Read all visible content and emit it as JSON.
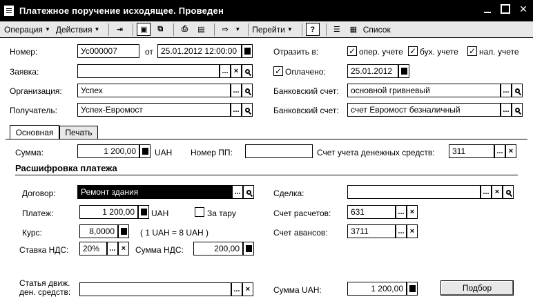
{
  "window": {
    "title": "Платежное поручение исходящее. Проведен",
    "controls": [
      "minimize",
      "maximize",
      "close"
    ]
  },
  "toolbar": {
    "operation": "Операция",
    "actions": "Действия",
    "goto": "Перейти",
    "help": "?",
    "list": "Список"
  },
  "header": {
    "number_label": "Номер:",
    "number_value": "Ус000007",
    "from_label": "от",
    "date_value": "25.01.2012 12:00:00",
    "request_label": "Заявка:",
    "request_value": "",
    "org_label": "Организация:",
    "org_value": "Успех",
    "recipient_label": "Получатель:",
    "recipient_value": "Успех-Евромост",
    "reflect_label": "Отразить в:",
    "reflect_oper": "опер. учете",
    "reflect_buh": "бух. учете",
    "reflect_nal": "нал. учете",
    "paid_label": "Оплачено:",
    "paid_date": "25.01.2012",
    "bank_label_1": "Банковский счет:",
    "bank_value_1": "основной гривневый",
    "bank_label_2": "Банковский счет:",
    "bank_value_2": "счет Евромост безналичный"
  },
  "tabs": {
    "main": "Основная",
    "print": "Печать"
  },
  "main_tab": {
    "sum_label": "Сумма:",
    "sum_value": "1 200,00",
    "currency": "UAH",
    "pp_label": "Номер ПП:",
    "pp_value": "",
    "cash_account_label": "Счет учета денежных средств:",
    "cash_account_value": "311",
    "section_title": "Расшифровка платежа",
    "contract_label": "Договор:",
    "contract_value": "Ремонт здания",
    "deal_label": "Сделка:",
    "deal_value": "",
    "payment_label": "Платеж:",
    "payment_value": "1 200,00",
    "payment_currency": "UAH",
    "for_goods_label": "За тару",
    "settlement_label": "Счет расчетов:",
    "settlement_value": "631",
    "rate_label": "Курс:",
    "rate_value": "8,0000",
    "rate_note": "( 1 UAH = 8 UAH )",
    "advance_label": "Счет авансов:",
    "advance_value": "3711",
    "vat_rate_label": "Ставка НДС:",
    "vat_rate_value": "20%",
    "vat_sum_label": "Сумма НДС:",
    "vat_sum_value": "200,00",
    "cashflow_label_1": "Статья движ.",
    "cashflow_label_2": "ден. средств:",
    "cashflow_value": "",
    "sum_uah_label": "Сумма UAH:",
    "sum_uah_value": "1 200,00",
    "select_button": "Подбор"
  },
  "glyphs": {
    "dots": "...",
    "clear": "×",
    "check": "✓"
  }
}
